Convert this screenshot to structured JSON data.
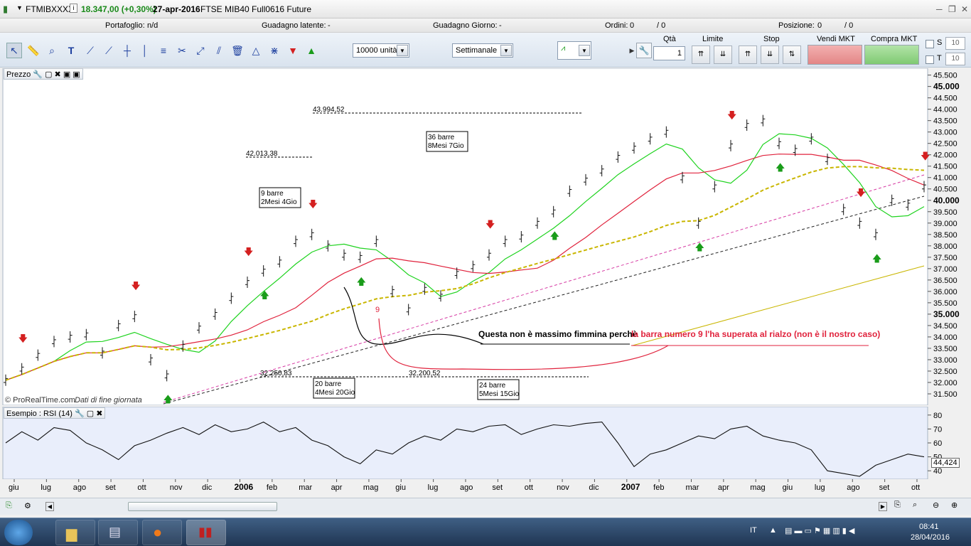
{
  "window": {
    "symbol": "FTMIBXXXX",
    "price": "18.347,00 (+0,30%)",
    "date": "27-apr-2016",
    "instrument": "FTSE MIB40 Full0616 Future",
    "close_glyph": "✕",
    "restore_glyph": "❐",
    "minimize_glyph": "─",
    "info_glyph": "i"
  },
  "account": {
    "portfolio_label": "Portafoglio:",
    "portfolio_value": "n/d",
    "unrealized_label": "Guadagno latente:",
    "unrealized_value": "-",
    "day_gain_label": "Guadagno Giorno:",
    "day_gain_value": "-",
    "orders_label": "Ordini:",
    "orders_a": "0",
    "orders_b": "/ 0",
    "position_label": "Posizione:",
    "position_a": "0",
    "position_b": "/ 0"
  },
  "toolbar": {
    "units": "10000 unità",
    "period": "Settimanale"
  },
  "order": {
    "qty_label": "Qtà",
    "qty_value": "1",
    "limit_label": "Limite",
    "stop_label": "Stop",
    "sell_label": "Vendi MKT",
    "buy_label": "Compra MKT",
    "s_label": "S",
    "t_label": "T",
    "s_value": "10",
    "t_value": "10"
  },
  "price_panel": {
    "title": "Prezzo",
    "copyright": "© ProRealTime.com",
    "data_note": "Dati di fine giornata"
  },
  "rsi_panel": {
    "title": "Esempio : RSI (14)",
    "last_value": "44,424"
  },
  "annotations": {
    "level1": "43.994,52",
    "level2": "42.013,38",
    "level3": "32.250,83",
    "level4": "32.200,52",
    "box1": [
      "36 barre",
      "8Mesi 7Gio"
    ],
    "box2": [
      "9 barre",
      "2Mesi 4Gio"
    ],
    "box3": [
      "20 barre",
      "4Mesi 20Gio"
    ],
    "box4": [
      "24 barre",
      "5Mesi 15Gio"
    ],
    "bar_num": "9",
    "note_black": "Questa non è massimo fimmina perchè",
    "note_red": "la barra numero 9 l'ha superata al rialzo (non è il nostro caso)"
  },
  "colors": {
    "sma_green": "#1ed31e",
    "sma_red": "#e0223c",
    "sma_yellow": "#c9b600",
    "trend_pink": "#d63aa3",
    "up_arrow": "#1a9c1a",
    "down_arrow": "#d42020",
    "accent": "#1d3f9e"
  },
  "chart_data": [
    {
      "type": "line",
      "title": "Prezzo",
      "ylim": [
        31000,
        45800
      ],
      "y_ticks": [
        "45.500",
        "45.000",
        "44.500",
        "44.000",
        "43.500",
        "43.000",
        "42.500",
        "42.000",
        "41.500",
        "41.000",
        "40.500",
        "40.000",
        "39.500",
        "39.000",
        "38.500",
        "38.000",
        "37.500",
        "37.000",
        "36.500",
        "36.000",
        "35.500",
        "35.000",
        "34.500",
        "34.000",
        "33.500",
        "33.000",
        "32.500",
        "32.000",
        "31.500"
      ],
      "x_ticks": [
        "giu",
        "lug",
        "ago",
        "set",
        "ott",
        "nov",
        "dic",
        "2006",
        "feb",
        "mar",
        "apr",
        "mag",
        "giu",
        "lug",
        "ago",
        "set",
        "ott",
        "nov",
        "dic",
        "2007",
        "feb",
        "mar",
        "apr",
        "mag",
        "giu",
        "lug",
        "ago",
        "set",
        "ott"
      ],
      "series": [
        {
          "values": [
            32100,
            32600,
            33200,
            33800,
            34000,
            34100,
            33300,
            34500,
            34900,
            33000,
            32300,
            33600,
            34400,
            35000,
            35700,
            36400,
            36900,
            37300,
            38200,
            38500,
            38000,
            37600,
            37500,
            38200,
            36000,
            35200,
            36100,
            35800,
            36800,
            37100,
            37600,
            38200,
            38400,
            39000,
            39500,
            40400,
            40900,
            41300,
            41900,
            42300,
            42700,
            43000,
            41000,
            39000,
            40600,
            42400,
            43300,
            43500,
            42500,
            42200,
            42700,
            41800,
            39600,
            39000,
            38500,
            40000,
            39800,
            40600
          ]
        }
      ]
    },
    {
      "type": "line",
      "title": "Esempio : RSI (14)",
      "ylim": [
        35,
        85
      ],
      "y_ticks": [
        "80",
        "70",
        "60",
        "50",
        "40"
      ],
      "series": [
        {
          "values": [
            60,
            68,
            62,
            71,
            69,
            60,
            55,
            48,
            58,
            62,
            67,
            71,
            66,
            73,
            68,
            70,
            75,
            68,
            71,
            62,
            58,
            50,
            45,
            55,
            52,
            60,
            65,
            62,
            70,
            68,
            72,
            73,
            66,
            70,
            73,
            72,
            74,
            75,
            60,
            43,
            52,
            55,
            60,
            65,
            63,
            70,
            72,
            65,
            62,
            60,
            55,
            40,
            38,
            36,
            44,
            48,
            52,
            50
          ]
        }
      ]
    }
  ]
}
